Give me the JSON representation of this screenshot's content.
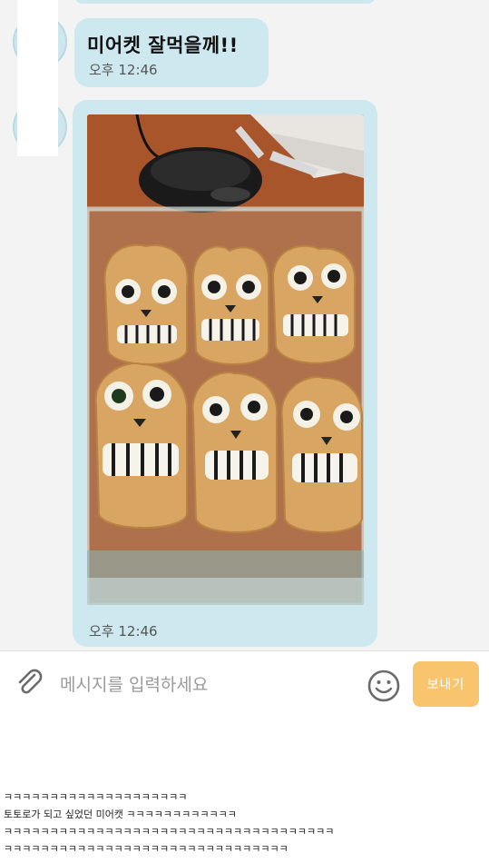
{
  "chat": {
    "message1": {
      "text": "미어켓 잘먹을께!!",
      "time": "오후 12:46"
    },
    "message2": {
      "time": "오후 12:46",
      "photo_description": "food photo"
    }
  },
  "input_bar": {
    "placeholder": "메시지를 입력하세요",
    "send_label": "보내기",
    "attach_icon": "paperclip-icon",
    "emoji_icon": "smiley-icon"
  },
  "caption": {
    "lines": [
      "ㅋㅋㅋㅋㅋㅋㅋㅋㅋㅋㅋㅋㅋㅋㅋㅋㅋㅋㅋㅋ",
      "토토로가 되고 싶었던 미어캣 ㅋㅋㅋㅋㅋㅋㅋㅋㅋㅋㅋㅋ",
      "ㅋㅋㅋㅋㅋㅋㅋㅋㅋㅋㅋㅋㅋㅋㅋㅋㅋㅋㅋㅋㅋㅋㅋㅋㅋㅋㅋㅋㅋㅋㅋㅋㅋㅋㅋㅋ",
      "ㅋㅋㅋㅋㅋㅋㅋㅋㅋㅋㅋㅋㅋㅋㅋㅋㅋㅋㅋㅋㅋㅋㅋㅋㅋㅋㅋㅋㅋㅋㅋ"
    ]
  },
  "colors": {
    "bubble": "#cde8ef",
    "send_button": "#f8c46e",
    "chat_bg": "#f3f3f3"
  }
}
